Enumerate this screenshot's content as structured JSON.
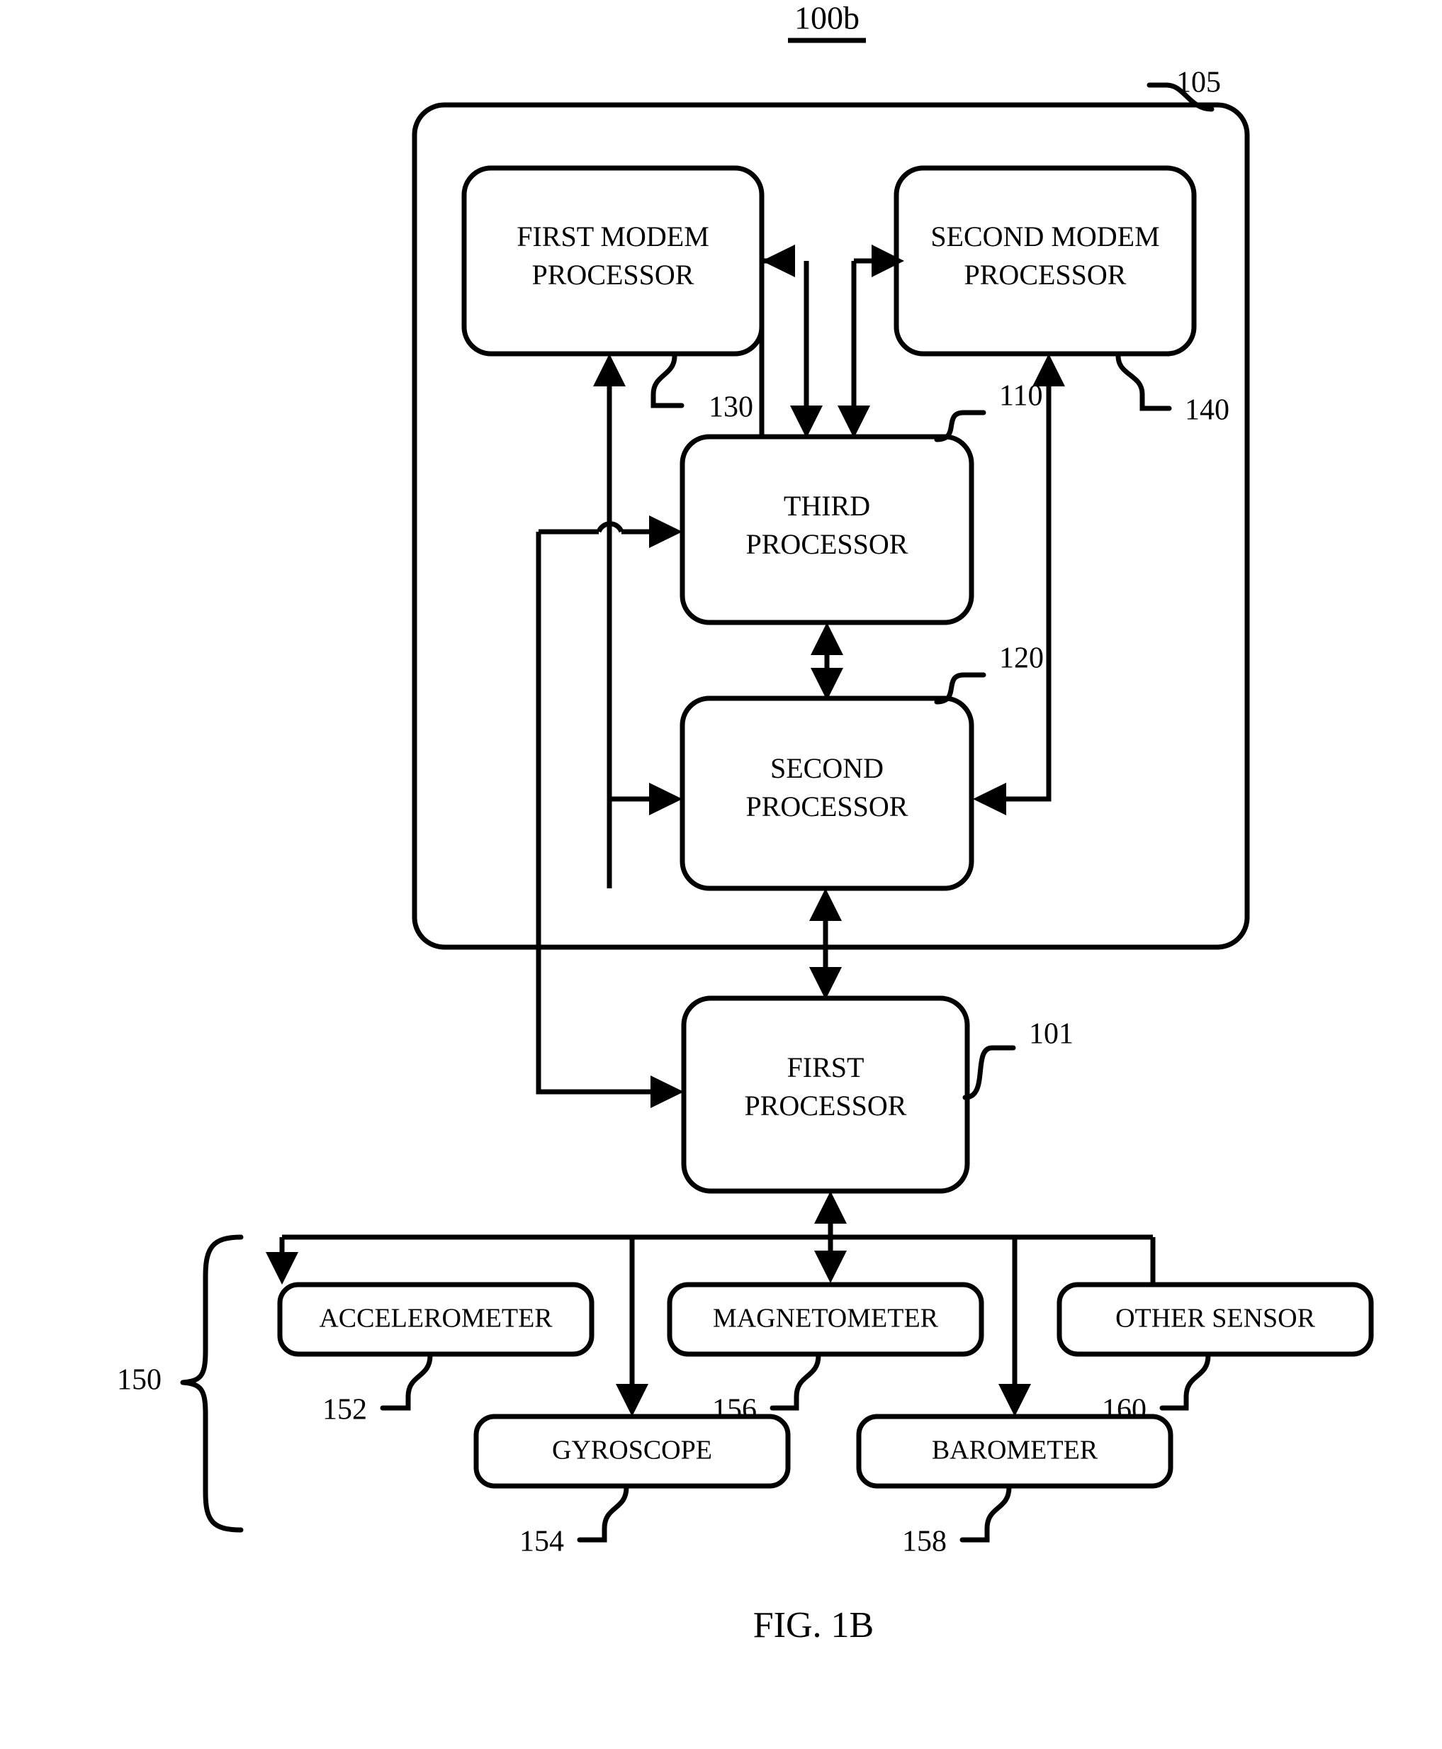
{
  "figure": {
    "top_label": "100b",
    "caption": "FIG. 1B"
  },
  "enclosure": {
    "ref": "105"
  },
  "blocks": {
    "first_modem_processor": {
      "line1": "FIRST MODEM",
      "line2": "PROCESSOR",
      "ref": "130"
    },
    "second_modem_processor": {
      "line1": "SECOND MODEM",
      "line2": "PROCESSOR",
      "ref": "140"
    },
    "third_processor": {
      "line1": "THIRD",
      "line2": "PROCESSOR",
      "ref": "110"
    },
    "second_processor": {
      "line1": "SECOND",
      "line2": "PROCESSOR",
      "ref": "120"
    },
    "first_processor": {
      "line1": "FIRST",
      "line2": "PROCESSOR",
      "ref": "101"
    }
  },
  "sensors": {
    "group_ref": "150",
    "items": [
      {
        "label": "ACCELEROMETER",
        "ref": "152"
      },
      {
        "label": "MAGNETOMETER",
        "ref": "156"
      },
      {
        "label": "OTHER SENSOR",
        "ref": "160"
      },
      {
        "label": "GYROSCOPE",
        "ref": "154"
      },
      {
        "label": "BAROMETER",
        "ref": "158"
      }
    ]
  },
  "colors": {
    "ink": "#000000",
    "paper": "#ffffff"
  }
}
